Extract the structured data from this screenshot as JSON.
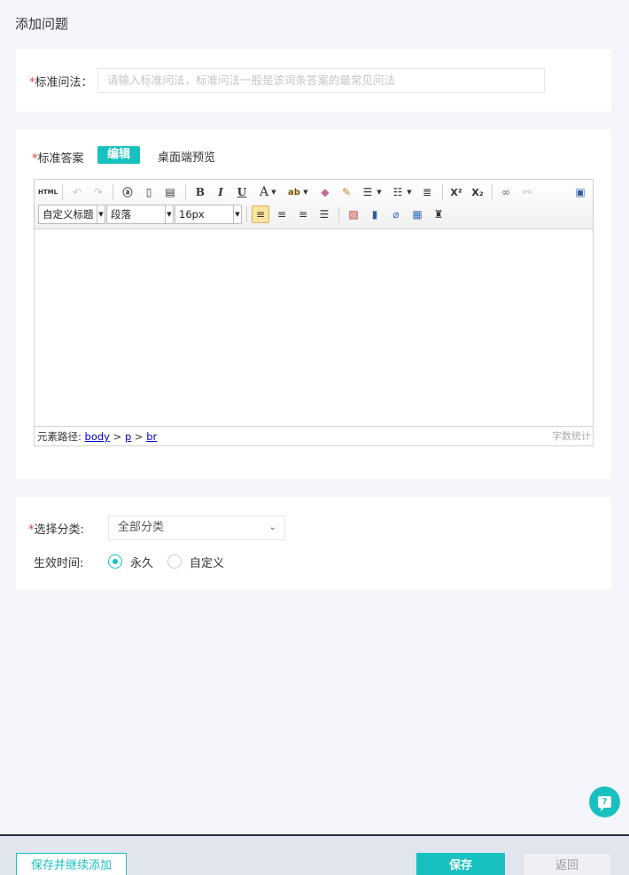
{
  "page": {
    "title": "添加问题"
  },
  "question": {
    "required_mark": "*",
    "label": "标准问法：",
    "placeholder": "请输入标准问法，标准问法一般是该词条答案的最常见问法"
  },
  "answer": {
    "required_mark": "*",
    "label": "标准答案",
    "tab_edit": "编辑",
    "tab_preview": "桌面端预览"
  },
  "editor": {
    "toolbar": {
      "html_label": "HTML",
      "font_style_combo": "自定义标题",
      "paragraph_combo": "段落",
      "font_size_combo": "16px",
      "bold": "B",
      "italic": "I",
      "underline": "U",
      "font_color": "A",
      "superscript": "X²",
      "subscript": "X₂"
    },
    "status": {
      "path_label": "元素路径:",
      "path": [
        "body",
        "p",
        "br"
      ],
      "separator": ">",
      "word_count": "字数统计"
    }
  },
  "category": {
    "required_mark": "*",
    "label": "选择分类:",
    "selected": "全部分类"
  },
  "effective_time": {
    "label": "生效时间:",
    "options": [
      "永久",
      "自定义"
    ],
    "selected_index": 0
  },
  "footer": {
    "save_continue": "保存并继续添加",
    "save": "保存",
    "back": "返回"
  },
  "colors": {
    "accent": "#18c1c0",
    "required": "#e4393c"
  }
}
